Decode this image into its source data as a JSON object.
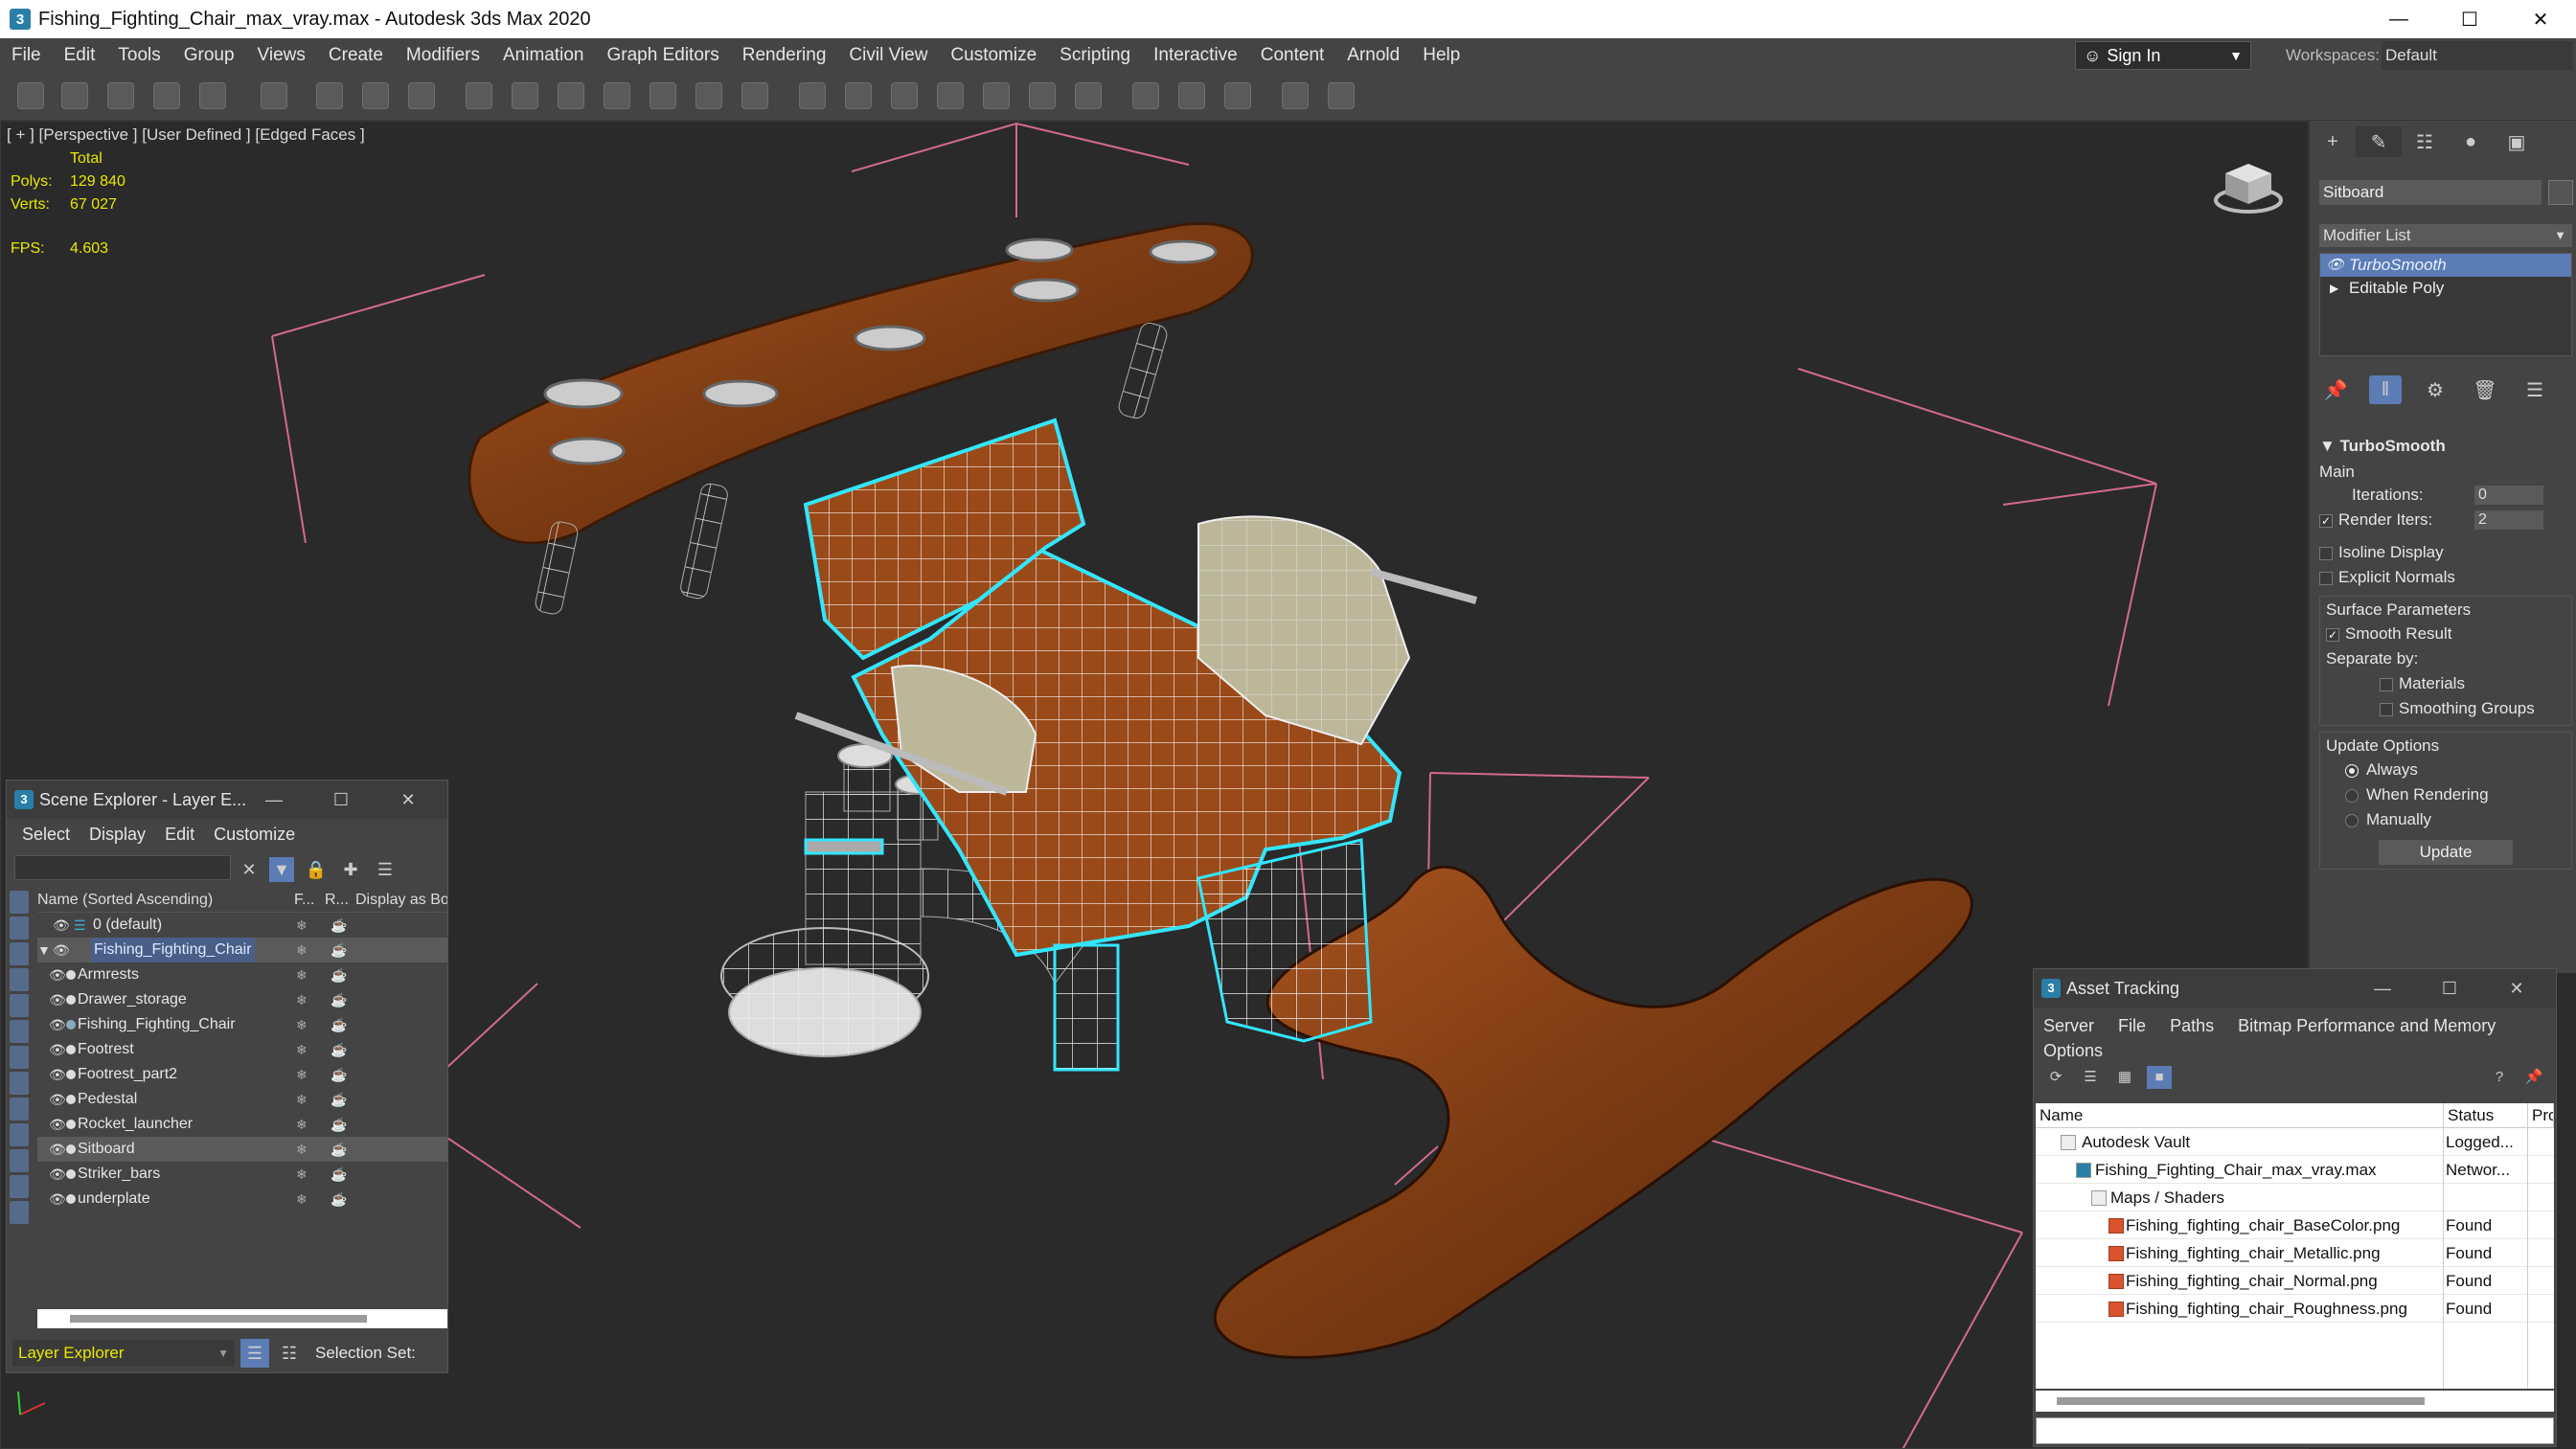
{
  "window": {
    "title": "Fishing_Fighting_Chair_max_vray.max - Autodesk 3ds Max 2020",
    "app_icon": "3"
  },
  "menu": [
    "File",
    "Edit",
    "Tools",
    "Group",
    "Views",
    "Create",
    "Modifiers",
    "Animation",
    "Graph Editors",
    "Rendering",
    "Civil View",
    "Customize",
    "Scripting",
    "Interactive",
    "Content",
    "Arnold",
    "Help"
  ],
  "signin": {
    "label": "Sign In"
  },
  "workspaces": {
    "label": "Workspaces:",
    "value": "Default"
  },
  "viewport": {
    "label": "[ + ] [Perspective ]  [User Defined ]  [Edged Faces ]",
    "stats": {
      "total": "Total",
      "polys_label": "Polys:",
      "polys": "129 840",
      "verts_label": "Verts:",
      "verts": "67 027",
      "fps_label": "FPS:",
      "fps": "4.603"
    }
  },
  "command_panel": {
    "object_name": "Sitboard",
    "modifier_list": "Modifier List",
    "stack": [
      "TurboSmooth",
      "Editable Poly"
    ],
    "rollout": {
      "title": "TurboSmooth",
      "main": "Main",
      "iterations_label": "Iterations:",
      "iterations": "0",
      "render_iters_label": "Render Iters:",
      "render_iters": "2",
      "isoline": "Isoline Display",
      "explicit_normals": "Explicit Normals",
      "surface_params": "Surface Parameters",
      "smooth_result": "Smooth Result",
      "separate_by": "Separate by:",
      "materials": "Materials",
      "smoothing_groups": "Smoothing Groups",
      "update_options": "Update Options",
      "always": "Always",
      "when_rendering": "When Rendering",
      "manually": "Manually",
      "update_button": "Update"
    }
  },
  "scene_explorer": {
    "title": "Scene Explorer - Layer E...",
    "menu": [
      "Select",
      "Display",
      "Edit",
      "Customize"
    ],
    "columns": {
      "name": "Name (Sorted Ascending)",
      "frozen": "F...",
      "renderable": "R...",
      "display": "Display as Bo"
    },
    "layers": [
      {
        "name": "0 (default)"
      },
      {
        "name": "Fishing_Fighting_Chair"
      }
    ],
    "objects": [
      "Armrests",
      "Drawer_storage",
      "Fishing_Fighting_Chair",
      "Footrest",
      "Footrest_part2",
      "Pedestal",
      "Rocket_launcher",
      "Sitboard",
      "Striker_bars",
      "underplate"
    ],
    "footer": {
      "explorer_type": "Layer Explorer",
      "selection_set": "Selection Set:"
    }
  },
  "asset_tracking": {
    "title": "Asset Tracking",
    "menu": [
      "Server",
      "File",
      "Paths",
      "Bitmap Performance and Memory",
      "Options"
    ],
    "columns": {
      "name": "Name",
      "status": "Status",
      "proxy": "Pro"
    },
    "rows": [
      {
        "name": "Autodesk Vault",
        "status": "Logged...",
        "indent": 0
      },
      {
        "name": "Fishing_Fighting_Chair_max_vray.max",
        "status": "Networ...",
        "indent": 1
      },
      {
        "name": "Maps / Shaders",
        "status": "",
        "indent": 2
      },
      {
        "name": "Fishing_fighting_chair_BaseColor.png",
        "status": "Found",
        "indent": 3
      },
      {
        "name": "Fishing_fighting_chair_Metallic.png",
        "status": "Found",
        "indent": 3
      },
      {
        "name": "Fishing_fighting_chair_Normal.png",
        "status": "Found",
        "indent": 3
      },
      {
        "name": "Fishing_fighting_chair_Roughness.png",
        "status": "Found",
        "indent": 3
      }
    ]
  },
  "colors": {
    "selection_outline": "#33e6ff",
    "wood": "#8a3d12",
    "stats_yellow": "#e8e800",
    "accent": "#5b7cb4"
  }
}
